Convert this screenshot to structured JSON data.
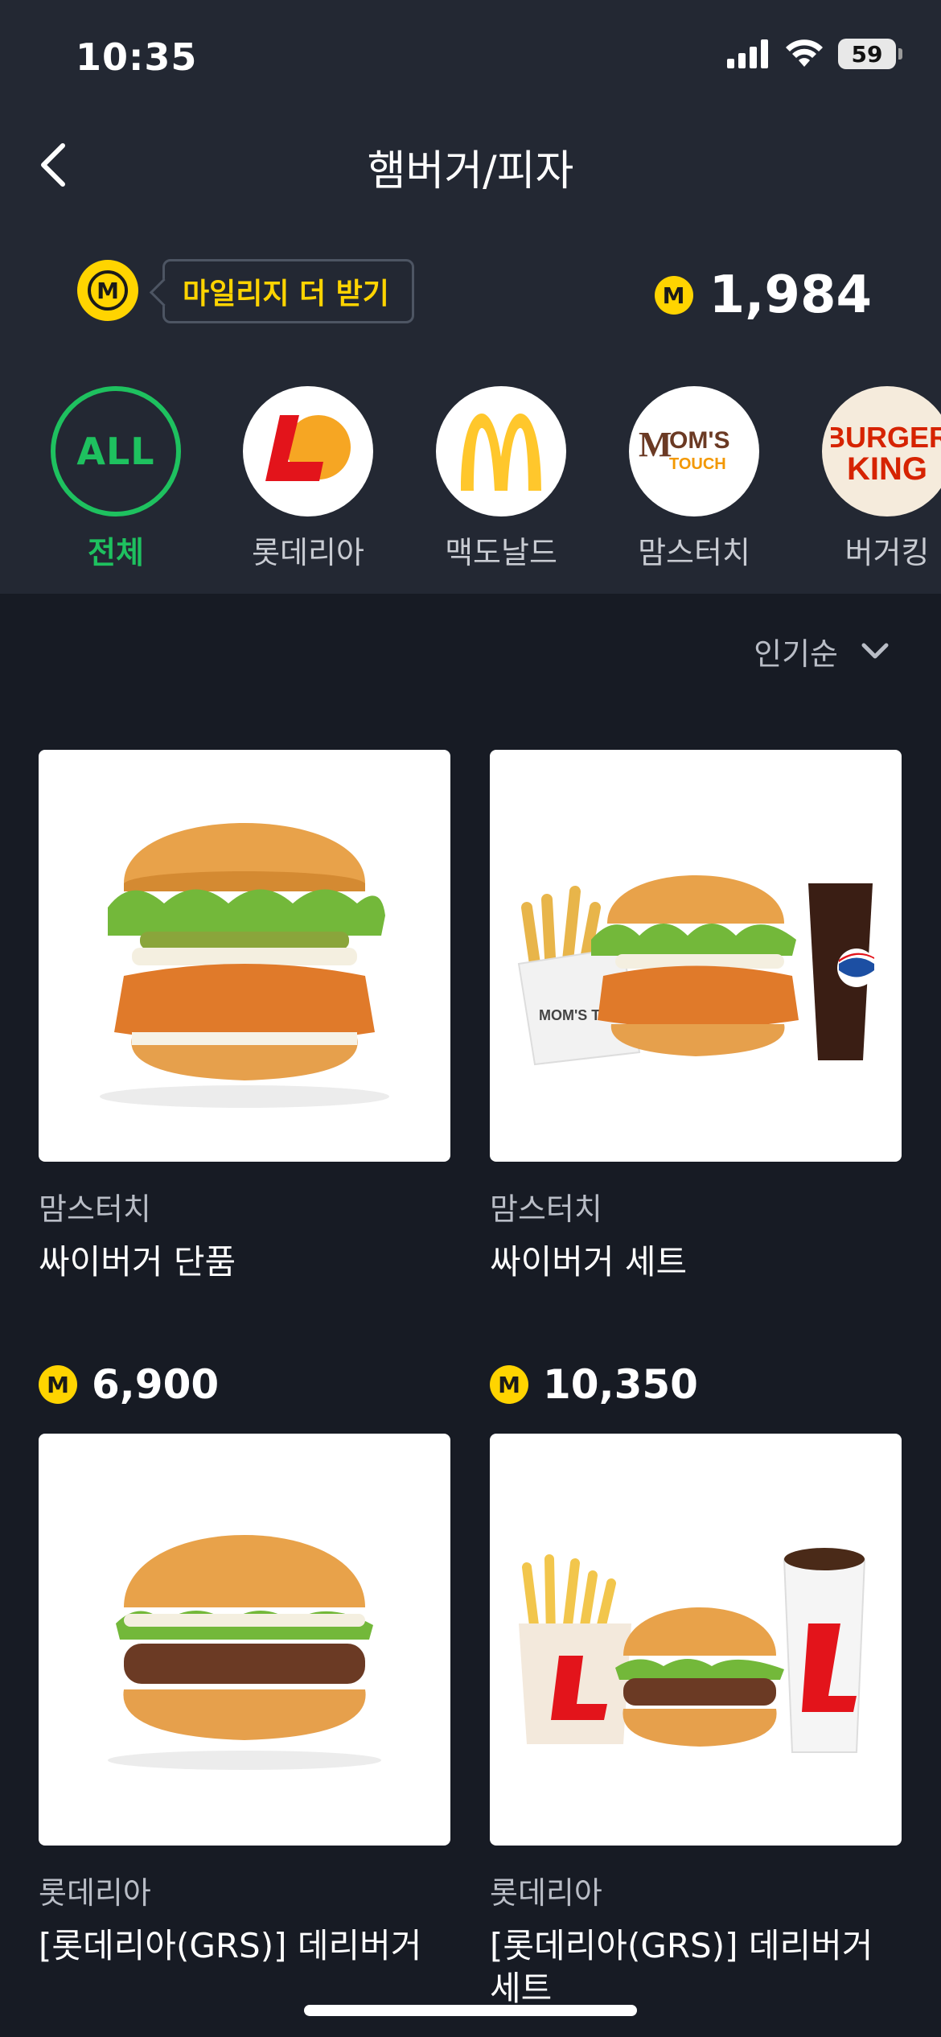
{
  "status_bar": {
    "time": "10:35",
    "battery": "59"
  },
  "header": {
    "title": "햄버거/피자"
  },
  "mileage": {
    "coin_letter": "M",
    "earn_more_label": "마일리지 더 받기",
    "balance": "1,984"
  },
  "brands": [
    {
      "label": "전체",
      "logo_text": "ALL",
      "active": true
    },
    {
      "label": "롯데리아",
      "logo_text": "L",
      "active": false
    },
    {
      "label": "맥도날드",
      "logo_text": "M",
      "active": false
    },
    {
      "label": "맘스터치",
      "logo_text": "MOM'S TOUCH",
      "active": false
    },
    {
      "label": "버거킹",
      "logo_text": "BURGER KING",
      "active": false
    }
  ],
  "sort": {
    "label": "인기순"
  },
  "products": [
    {
      "brand": "맘스터치",
      "name": "싸이버거 단품",
      "price": "6,900"
    },
    {
      "brand": "맘스터치",
      "name": "싸이버거 세트",
      "price": "10,350"
    },
    {
      "brand": "롯데리아",
      "name": "[롯데리아(GRS)] 데리버거",
      "price": ""
    },
    {
      "brand": "롯데리아",
      "name": "[롯데리아(GRS)] 데리버거세트",
      "price": ""
    }
  ],
  "colors": {
    "accent_green": "#1ec15f",
    "coin_yellow": "#ffd400",
    "bg": "#171b24",
    "top_bg": "#232833"
  }
}
